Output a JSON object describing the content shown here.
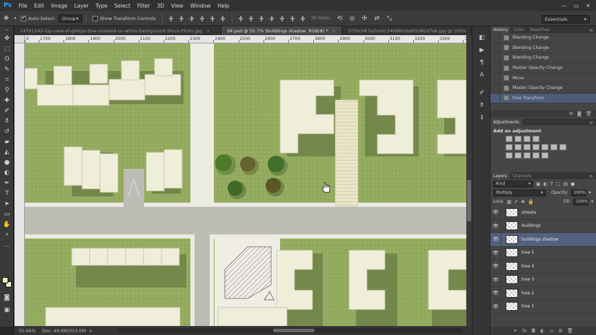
{
  "app": {
    "logo": "Ps"
  },
  "menu": [
    "File",
    "Edit",
    "Image",
    "Layer",
    "Type",
    "Select",
    "Filter",
    "3D",
    "View",
    "Window",
    "Help"
  ],
  "options": {
    "auto_select_label": "Auto-Select:",
    "auto_select_value": "Group",
    "show_transform_label": "Show Transform Controls",
    "mode3d_label": "3D Mode:",
    "workspace": "Essentials"
  },
  "tabs": [
    {
      "title": "14701242-top-view-of-ginkgo-tree-isolated-on-white-background-Stock-Photo.jpg",
      "active": false
    },
    {
      "title": "d4.psd @ 55.7% (buildings shadow, RGB/8) *",
      "active": true
    },
    {
      "title": "3730c067a3ce013408802bd65d82d7eb.jpg @ 100%",
      "active": false
    }
  ],
  "ruler": [
    "0",
    "1700",
    "1800",
    "1900",
    "2000",
    "2100",
    "2200",
    "2300",
    "2400",
    "2500",
    "2600",
    "2700",
    "2800",
    "2900",
    "3000",
    "3100",
    "3200",
    "3300",
    "3400"
  ],
  "status": {
    "zoom": "55.66%",
    "doc": "Doc: 49.8M/323.0M"
  },
  "colors": {
    "foreground": "#f2f0b0",
    "background": "#f4f2d6",
    "grass": "#8fa85a",
    "road": "#bdbdb5",
    "building": "#efeed9"
  },
  "history": {
    "tabs": [
      "History",
      "Color",
      "Swatches"
    ],
    "items": [
      {
        "label": "Blending Change",
        "selected": false
      },
      {
        "label": "Blending Change",
        "selected": false
      },
      {
        "label": "Blending Change",
        "selected": false
      },
      {
        "label": "Master Opacity Change",
        "selected": false
      },
      {
        "label": "Move",
        "selected": false
      },
      {
        "label": "Master Opacity Change",
        "selected": false
      },
      {
        "label": "Free Transform",
        "selected": true
      }
    ]
  },
  "adjustments": {
    "tab": "Adjustments",
    "heading": "Add an adjustment"
  },
  "layers": {
    "tabs": [
      "Layers",
      "Channels"
    ],
    "kind": "Kind",
    "blend_mode": "Multiply",
    "opacity_label": "Opacity:",
    "opacity_value": "100%",
    "lock_label": "Lock:",
    "fill_label": "Fill:",
    "fill_value": "100%",
    "items": [
      {
        "name": "streets",
        "selected": false
      },
      {
        "name": "buildings",
        "selected": false
      },
      {
        "name": "buildings shadow",
        "selected": true
      },
      {
        "name": "tree 5",
        "selected": false
      },
      {
        "name": "tree 4",
        "selected": false
      },
      {
        "name": "tree 3",
        "selected": false
      },
      {
        "name": "tree 2",
        "selected": false
      },
      {
        "name": "tree 1",
        "selected": false
      }
    ]
  }
}
